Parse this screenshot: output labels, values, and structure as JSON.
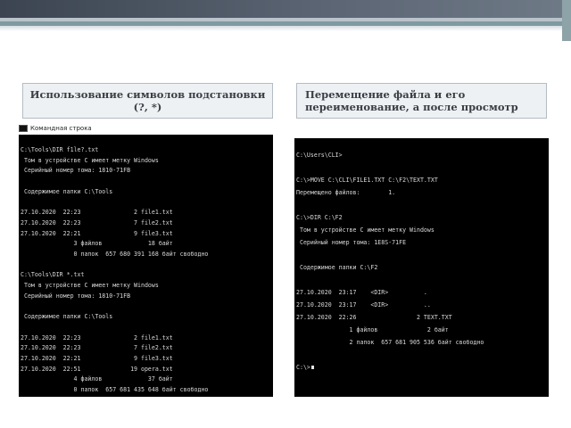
{
  "slide": {
    "left_heading": "Использование символов подстановки (?, *)",
    "right_heading": "Перемещение файла и его переименование, а после просмотр"
  },
  "left_window": {
    "title": "Командная строка",
    "lines": [
      "C:\\Tools\\DIR f1le?.txt",
      " Том в устройстве C имеет метку Windows",
      " Серийный номер тома: 1810-71FB",
      "",
      " Содержимое папки C:\\Tools",
      "",
      "27.10.2020  22:23               2 file1.txt",
      "27.10.2020  22:23               7 file2.txt",
      "27.10.2020  22:21               9 file3.txt",
      "               3 файлов             18 байт",
      "               0 папок  657 680 391 168 байт свободно",
      "",
      "C:\\Tools\\DIR *.txt",
      " Том в устройстве C имеет метку Windows",
      " Серийный номер тома: 1810-71FB",
      "",
      " Содержимое папки C:\\Tools",
      "",
      "27.10.2020  22:23               2 file1.txt",
      "27.10.2020  22:23               7 file2.txt",
      "27.10.2020  22:21               9 file3.txt",
      "27.10.2020  22:51              19 opera.txt",
      "               4 файлов             37 байт",
      "               0 папок  657 681 435 648 байт свободно"
    ]
  },
  "right_window": {
    "lines": [
      "C:\\Users\\CLI>",
      "",
      "C:\\>MOVE C:\\CLI\\FILE1.TXT C:\\F2\\TEXT.TXT",
      "Перемещено файлов:        1.",
      "",
      "C:\\>DIR C:\\F2",
      " Том в устройстве C имеет метку Windows",
      " Серийный номер тома: 1E8S-71FE",
      "",
      " Содержимое папки C:\\F2",
      "",
      "27.10.2020  23:17    <DIR>          .",
      "27.10.2020  23:17    <DIR>          ..",
      "27.10.2020  22:26                 2 TEXT.TXT",
      "               1 файлов              2 байт",
      "               2 папок  657 681 905 536 байт свободно",
      "",
      "C:\\>"
    ]
  }
}
